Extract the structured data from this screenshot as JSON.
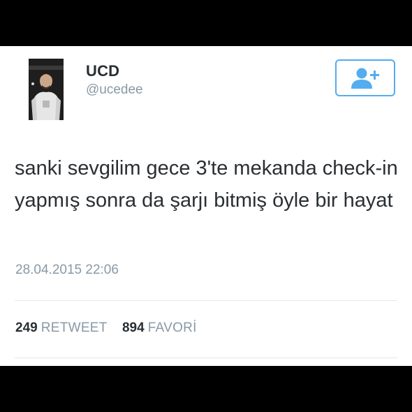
{
  "user": {
    "display_name": "UCD",
    "handle": "@ucedee"
  },
  "follow_button": {
    "icon": "add-user-icon",
    "color": "#55acee"
  },
  "tweet": {
    "text": "sanki sevgilim gece 3'te mekanda check-in yapmış sonra da şarjı bitmiş öyle bir hayat",
    "timestamp": "28.04.2015 22:06"
  },
  "stats": {
    "retweet_count": "249",
    "retweet_label": "RETWEET",
    "favorite_count": "894",
    "favorite_label": "FAVORİ"
  },
  "colors": {
    "text_primary": "#292f33",
    "text_secondary": "#8899a6",
    "accent": "#55acee",
    "divider": "#e1e8ed"
  }
}
